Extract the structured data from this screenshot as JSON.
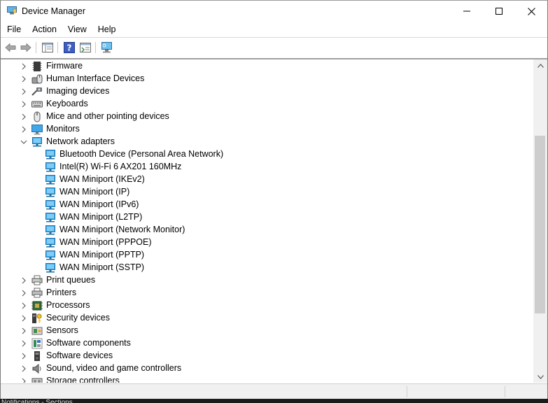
{
  "window": {
    "title": "Device Manager",
    "minimize_label": "",
    "maximize_label": "",
    "close_label": ""
  },
  "menu": [
    "File",
    "Action",
    "View",
    "Help"
  ],
  "tree": [
    {
      "label": "Firmware",
      "level": 0,
      "expanded": false,
      "icon": "firmware-icon"
    },
    {
      "label": "Human Interface Devices",
      "level": 0,
      "expanded": false,
      "icon": "hid-icon"
    },
    {
      "label": "Imaging devices",
      "level": 0,
      "expanded": false,
      "icon": "camera-icon"
    },
    {
      "label": "Keyboards",
      "level": 0,
      "expanded": false,
      "icon": "keyboard-icon"
    },
    {
      "label": "Mice and other pointing devices",
      "level": 0,
      "expanded": false,
      "icon": "mouse-icon"
    },
    {
      "label": "Monitors",
      "level": 0,
      "expanded": false,
      "icon": "monitor-icon"
    },
    {
      "label": "Network adapters",
      "level": 0,
      "expanded": true,
      "icon": "network-adapter-icon"
    },
    {
      "label": "Bluetooth Device (Personal Area Network)",
      "level": 1,
      "icon": "network-adapter-icon"
    },
    {
      "label": "Intel(R) Wi-Fi 6 AX201 160MHz",
      "level": 1,
      "icon": "network-adapter-icon"
    },
    {
      "label": "WAN Miniport (IKEv2)",
      "level": 1,
      "icon": "network-adapter-icon"
    },
    {
      "label": "WAN Miniport (IP)",
      "level": 1,
      "icon": "network-adapter-icon"
    },
    {
      "label": "WAN Miniport (IPv6)",
      "level": 1,
      "icon": "network-adapter-icon"
    },
    {
      "label": "WAN Miniport (L2TP)",
      "level": 1,
      "icon": "network-adapter-icon"
    },
    {
      "label": "WAN Miniport (Network Monitor)",
      "level": 1,
      "icon": "network-adapter-icon"
    },
    {
      "label": "WAN Miniport (PPPOE)",
      "level": 1,
      "icon": "network-adapter-icon"
    },
    {
      "label": "WAN Miniport (PPTP)",
      "level": 1,
      "icon": "network-adapter-icon"
    },
    {
      "label": "WAN Miniport (SSTP)",
      "level": 1,
      "icon": "network-adapter-icon"
    },
    {
      "label": "Print queues",
      "level": 0,
      "expanded": false,
      "icon": "print-queue-icon"
    },
    {
      "label": "Printers",
      "level": 0,
      "expanded": false,
      "icon": "printer-icon"
    },
    {
      "label": "Processors",
      "level": 0,
      "expanded": false,
      "icon": "processor-icon"
    },
    {
      "label": "Security devices",
      "level": 0,
      "expanded": false,
      "icon": "security-key-icon"
    },
    {
      "label": "Sensors",
      "level": 0,
      "expanded": false,
      "icon": "sensor-icon"
    },
    {
      "label": "Software components",
      "level": 0,
      "expanded": false,
      "icon": "software-component-icon"
    },
    {
      "label": "Software devices",
      "level": 0,
      "expanded": false,
      "icon": "software-device-icon"
    },
    {
      "label": "Sound, video and game controllers",
      "level": 0,
      "expanded": false,
      "icon": "speaker-icon"
    },
    {
      "label": "Storage controllers",
      "level": 0,
      "expanded": false,
      "icon": "storage-controller-icon"
    }
  ],
  "scroll": {
    "position_fraction": 0.35
  },
  "taskbar": {
    "text": "Notifications - Sections"
  },
  "colors": {
    "netblue": "#2a8fd6",
    "chevron": "#5f5f5f",
    "thumb": "#cdcdcd"
  }
}
